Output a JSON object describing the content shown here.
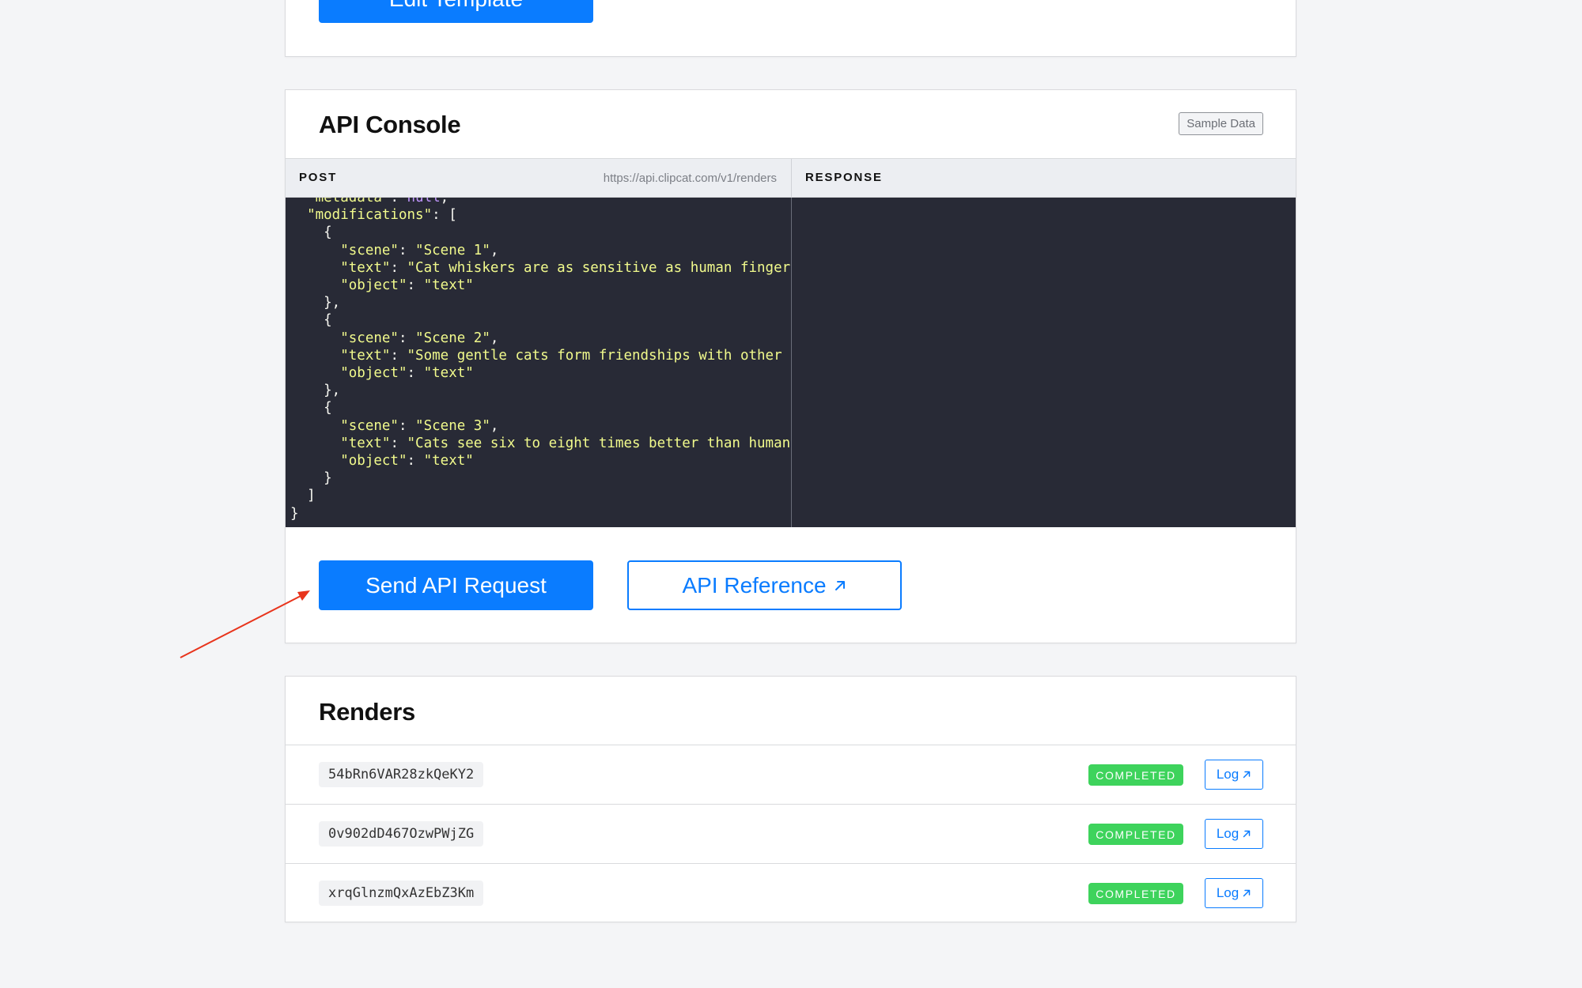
{
  "top_card": {
    "edit_label": "Edit Template"
  },
  "console": {
    "title": "API Console",
    "sample_badge": "Sample Data",
    "post_label": "POST",
    "endpoint": "https://api.clipcat.com/v1/renders",
    "response_label": "RESPONSE",
    "code_lines": [
      {
        "text": "  \"metadata\": null,",
        "parts": [
          [
            "  \"metadata\"",
            "s"
          ],
          [
            ": ",
            "p"
          ],
          [
            "null",
            "kw"
          ],
          [
            ",",
            "p"
          ]
        ]
      },
      {
        "parts": [
          [
            "  \"modifications\"",
            "s"
          ],
          [
            ": [",
            "p"
          ]
        ]
      },
      {
        "parts": [
          [
            "    {",
            "p"
          ]
        ]
      },
      {
        "parts": [
          [
            "      \"scene\"",
            "s"
          ],
          [
            ": ",
            "p"
          ],
          [
            "\"Scene 1\"",
            "s"
          ],
          [
            ",",
            "p"
          ]
        ]
      },
      {
        "parts": [
          [
            "      \"text\"",
            "s"
          ],
          [
            ": ",
            "p"
          ],
          [
            "\"Cat whiskers are as sensitive as human fingertips",
            "s"
          ]
        ]
      },
      {
        "parts": [
          [
            "      \"object\"",
            "s"
          ],
          [
            ": ",
            "p"
          ],
          [
            "\"text\"",
            "s"
          ]
        ]
      },
      {
        "parts": [
          [
            "    },",
            "p"
          ]
        ]
      },
      {
        "parts": [
          [
            "    {",
            "p"
          ]
        ]
      },
      {
        "parts": [
          [
            "      \"scene\"",
            "s"
          ],
          [
            ": ",
            "p"
          ],
          [
            "\"Scene 2\"",
            "s"
          ],
          [
            ",",
            "p"
          ]
        ]
      },
      {
        "parts": [
          [
            "      \"text\"",
            "s"
          ],
          [
            ": ",
            "p"
          ],
          [
            "\"Some gentle cats form friendships with other anim",
            "s"
          ]
        ]
      },
      {
        "parts": [
          [
            "      \"object\"",
            "s"
          ],
          [
            ": ",
            "p"
          ],
          [
            "\"text\"",
            "s"
          ]
        ]
      },
      {
        "parts": [
          [
            "    },",
            "p"
          ]
        ]
      },
      {
        "parts": [
          [
            "    {",
            "p"
          ]
        ]
      },
      {
        "parts": [
          [
            "      \"scene\"",
            "s"
          ],
          [
            ": ",
            "p"
          ],
          [
            "\"Scene 3\"",
            "s"
          ],
          [
            ",",
            "p"
          ]
        ]
      },
      {
        "parts": [
          [
            "      \"text\"",
            "s"
          ],
          [
            ": ",
            "p"
          ],
          [
            "\"Cats see six to eight times better than humans in",
            "s"
          ]
        ]
      },
      {
        "parts": [
          [
            "      \"object\"",
            "s"
          ],
          [
            ": ",
            "p"
          ],
          [
            "\"text\"",
            "s"
          ]
        ]
      },
      {
        "parts": [
          [
            "    }",
            "p"
          ]
        ]
      },
      {
        "parts": [
          [
            "  ]",
            "p"
          ]
        ]
      },
      {
        "parts": [
          [
            "}",
            "p"
          ]
        ]
      }
    ],
    "send_label": "Send API Request",
    "reference_label": "API Reference"
  },
  "renders": {
    "title": "Renders",
    "rows": [
      {
        "id": "54bRn6VAR28zkQeKY2",
        "status": "COMPLETED",
        "log_label": "Log"
      },
      {
        "id": "0v902dD467OzwPWjZG",
        "status": "COMPLETED",
        "log_label": "Log"
      },
      {
        "id": "xrqGlnzmQxAzEbZ3Km",
        "status": "COMPLETED",
        "log_label": "Log"
      }
    ]
  },
  "colors": {
    "accent": "#0a7cff",
    "success": "#3ed35c",
    "code_bg": "#282a36",
    "annotation_arrow": "#e8341c"
  }
}
